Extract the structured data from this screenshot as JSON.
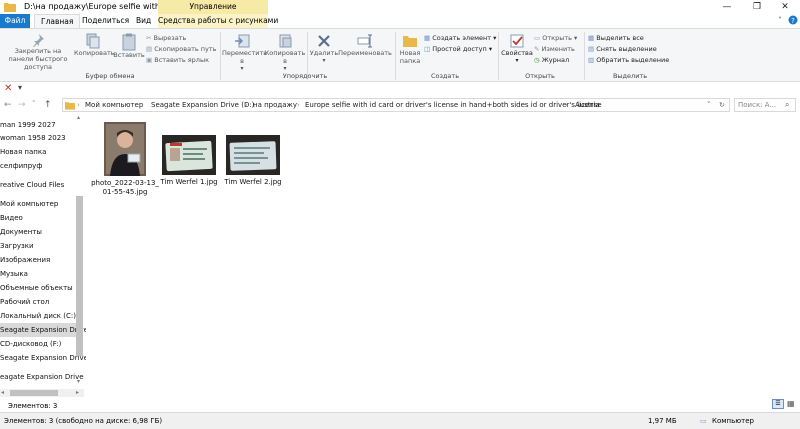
{
  "window": {
    "title": "D:\\на продажу\\Europe selfie with id card or ...",
    "context_tab_header": "Управление",
    "controls": {
      "minimize": "—",
      "maximize": "❐",
      "close": "✕"
    }
  },
  "tabs": {
    "file": "Файл",
    "home": "Главная",
    "share": "Поделиться",
    "view": "Вид",
    "picture_tools": "Средства работы с рисунками"
  },
  "ribbon": {
    "clipboard": {
      "pin": "Закрепить на панели быстрого доступа",
      "copy": "Копировать",
      "paste": "Вставить",
      "cut": "Вырезать",
      "copy_path": "Скопировать путь",
      "paste_shortcut": "Вставить ярлык",
      "group": "Буфер обмена"
    },
    "organize": {
      "move_to": "Переместить в",
      "copy_to": "Копировать в",
      "delete": "Удалить",
      "rename": "Переименовать",
      "group": "Упорядочить"
    },
    "create": {
      "new_folder": "Новая папка",
      "new_item": "Создать элемент",
      "easy_access": "Простой доступ",
      "group": "Создать"
    },
    "open": {
      "properties": "Свойства",
      "open": "Открыть",
      "edit": "Изменить",
      "history": "Журнал",
      "group": "Открыть"
    },
    "select": {
      "select_all": "Выделить все",
      "select_none": "Снять выделение",
      "invert": "Обратить выделение",
      "group": "Выделить"
    }
  },
  "address": {
    "crumbs": [
      "Мой компьютер",
      "Seagate Expansion Drive (D:)",
      "на продажу",
      "Europe selfie with id card or driver's license in hand+both sides id or driver's license",
      "Austria"
    ],
    "search_placeholder": "Поиск: A..."
  },
  "nav": {
    "items": [
      "man 1999 2027",
      "woman 1958 2023",
      "Новая папка",
      "селфипруф",
      "reative Cloud Files",
      "Мой компьютер",
      "Видео",
      "Документы",
      "Загрузки",
      "Изображения",
      "Музыка",
      "Объемные объекты",
      "Рабочий стол",
      "Локальный диск (C:)",
      "Seagate Expansion Drive",
      "CD-дисковод (F:)",
      "Seagate Expansion Drive",
      "eagate Expansion Drive ("
    ]
  },
  "files": [
    {
      "name": "photo_2022-03-13_01-55-45.jpg"
    },
    {
      "name": "Tim Werfel 1.jpg"
    },
    {
      "name": "Tim Werfel 2.jpg"
    }
  ],
  "status": {
    "count": "Элементов: 3",
    "count_free": "Элементов: 3 (свободно на диске: 6,98 ГБ)",
    "size": "1,97 МБ",
    "location": "Компьютер"
  },
  "colors": {
    "accent": "#1979ca",
    "context": "#f7e9a6",
    "folder": "#e8b94a"
  }
}
